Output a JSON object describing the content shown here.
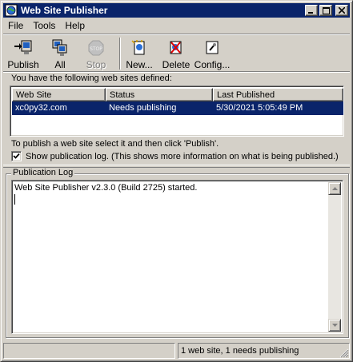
{
  "window": {
    "title": "Web Site Publisher",
    "icon": "globe-app-icon"
  },
  "menu": [
    "File",
    "Tools",
    "Help"
  ],
  "toolbar": {
    "publish": "Publish",
    "all": "All",
    "stop": "Stop",
    "new": "New...",
    "delete": "Delete",
    "config": "Config..."
  },
  "sites": {
    "intro": "You have the following web sites defined:",
    "columns": [
      "Web Site",
      "Status",
      "Last Published"
    ],
    "rows": [
      {
        "site": "xc0py32.com",
        "status": "Needs publishing",
        "last_published": "5/30/2021 5:05:49 PM",
        "selected": true
      }
    ]
  },
  "instructions": "To publish a web site select it and then click 'Publish'.",
  "show_log": {
    "checked": true,
    "label": "Show publication log. (This shows more information on what is being published.)"
  },
  "log": {
    "label": "Publication Log",
    "text": "Web Site Publisher v2.3.0 (Build 2725) started."
  },
  "status": {
    "left": "",
    "right": "1 web site, 1 needs publishing"
  },
  "colors": {
    "face": "#d4d0c8",
    "selection": "#0a246a",
    "titlebar": "#0a246a"
  }
}
